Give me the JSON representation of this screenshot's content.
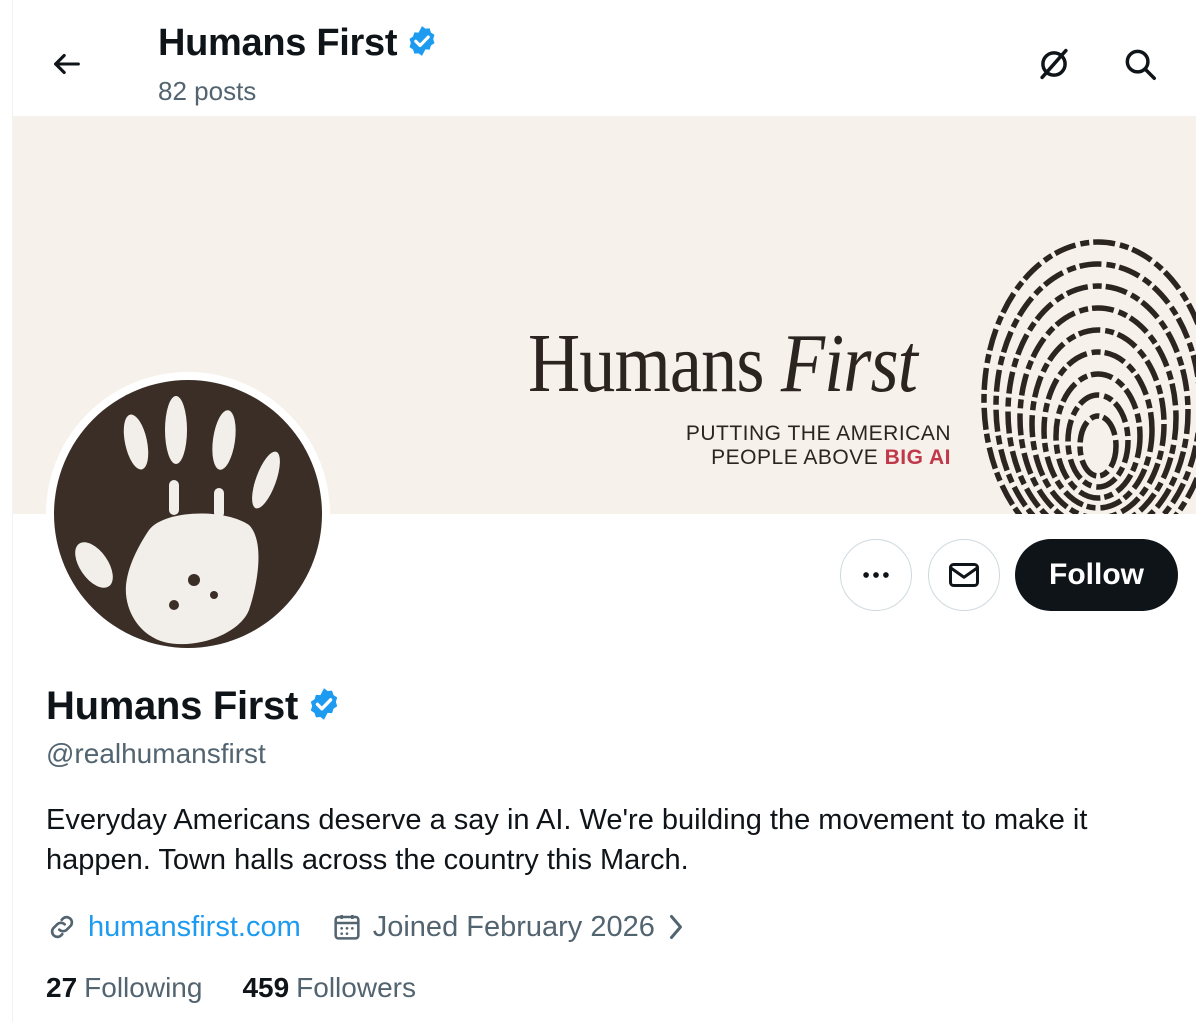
{
  "header": {
    "title": "Humans First",
    "post_count": "82 posts"
  },
  "banner": {
    "title_main": "Humans",
    "title_emphasis": "First",
    "tagline_line1": "PUTTING THE AMERICAN",
    "tagline_line2_prefix": "PEOPLE ABOVE",
    "tagline_line2_highlight": "BIG AI",
    "highlight_color": "#c0394b"
  },
  "actions": {
    "more_icon": "more-horizontal-icon",
    "message_icon": "envelope-icon",
    "follow_label": "Follow"
  },
  "profile": {
    "name": "Humans First",
    "handle": "@realhumansfirst",
    "bio": "Everyday Americans deserve a say in AI. We're building the movement to make it happen. Town halls across the country this March.",
    "website": "humansfirst.com",
    "joined": "Joined February 2026"
  },
  "stats": {
    "following_count": "27",
    "following_label": "Following",
    "followers_count": "459",
    "followers_label": "Followers"
  },
  "colors": {
    "verified": "#1d9bf0",
    "link": "#1d9bf0",
    "follow_bg": "#0f1419",
    "banner_bg": "#f6f1eb",
    "avatar_bg": "#3a2e27"
  }
}
